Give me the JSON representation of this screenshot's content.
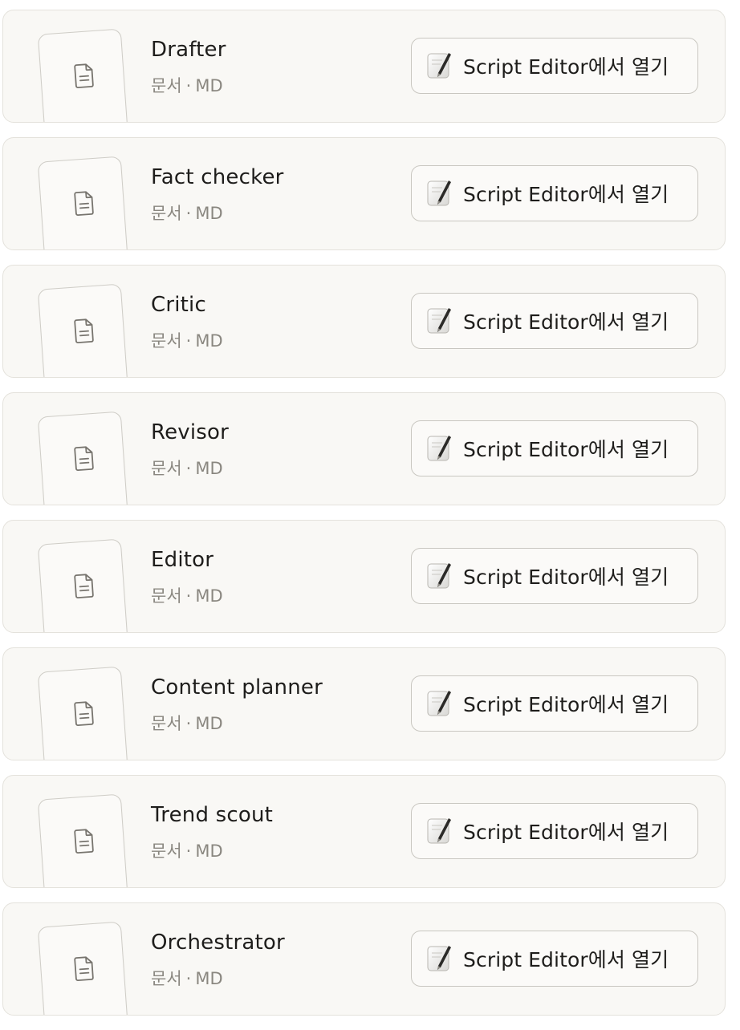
{
  "items": [
    {
      "title": "Drafter",
      "type_label": "문서",
      "separator": "·",
      "format": "MD",
      "action_label": "Script Editor에서 열기",
      "doc_icon": "document-icon",
      "app_icon": "script-editor-icon"
    },
    {
      "title": "Fact checker",
      "type_label": "문서",
      "separator": "·",
      "format": "MD",
      "action_label": "Script Editor에서 열기",
      "doc_icon": "document-icon",
      "app_icon": "script-editor-icon"
    },
    {
      "title": "Critic",
      "type_label": "문서",
      "separator": "·",
      "format": "MD",
      "action_label": "Script Editor에서 열기",
      "doc_icon": "document-icon",
      "app_icon": "script-editor-icon"
    },
    {
      "title": "Revisor",
      "type_label": "문서",
      "separator": "·",
      "format": "MD",
      "action_label": "Script Editor에서 열기",
      "doc_icon": "document-icon",
      "app_icon": "script-editor-icon"
    },
    {
      "title": "Editor",
      "type_label": "문서",
      "separator": "·",
      "format": "MD",
      "action_label": "Script Editor에서 열기",
      "doc_icon": "document-icon",
      "app_icon": "script-editor-icon"
    },
    {
      "title": "Content planner",
      "type_label": "문서",
      "separator": "·",
      "format": "MD",
      "action_label": "Script Editor에서 열기",
      "doc_icon": "document-icon",
      "app_icon": "script-editor-icon"
    },
    {
      "title": "Trend scout",
      "type_label": "문서",
      "separator": "·",
      "format": "MD",
      "action_label": "Script Editor에서 열기",
      "doc_icon": "document-icon",
      "app_icon": "script-editor-icon"
    },
    {
      "title": "Orchestrator",
      "type_label": "문서",
      "separator": "·",
      "format": "MD",
      "action_label": "Script Editor에서 열기",
      "doc_icon": "document-icon",
      "app_icon": "script-editor-icon"
    }
  ],
  "colors": {
    "card_bg": "#f9f8f5",
    "card_border": "#e4e2dc",
    "text_primary": "#1e1d1b",
    "text_secondary": "#8a8780"
  }
}
